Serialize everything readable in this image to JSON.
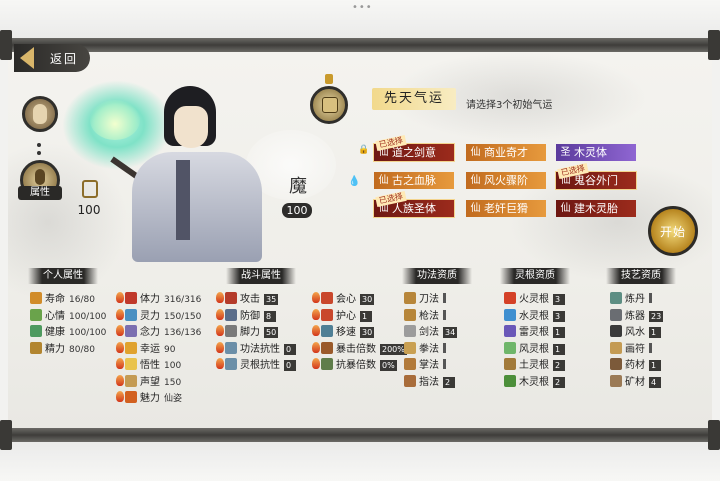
{
  "nav": {
    "back_label": "返回"
  },
  "avatar": {
    "attr_label": "属性"
  },
  "character": {
    "left_value": "100",
    "right_glyph": "魔",
    "right_value": "100"
  },
  "fate": {
    "title": "先天气运",
    "hint": "请选择3个初始气运",
    "chosen_tag": "已选择",
    "traits": [
      {
        "label": "道之剑意",
        "color": "red",
        "selected": true
      },
      {
        "label": "商业奇才",
        "color": "orange",
        "selected": false
      },
      {
        "label": "木灵体",
        "color": "purple",
        "selected": false
      },
      {
        "label": "古之血脉",
        "color": "orange",
        "selected": false
      },
      {
        "label": "风火骤阶",
        "color": "orange",
        "selected": false
      },
      {
        "label": "鬼谷外门",
        "color": "red",
        "selected": true
      },
      {
        "label": "人族圣体",
        "color": "red",
        "selected": true
      },
      {
        "label": "老奸巨猾",
        "color": "orange",
        "selected": false
      },
      {
        "label": "建木灵胎",
        "color": "red",
        "selected": false
      }
    ]
  },
  "start_label": "开始",
  "sections": {
    "personal": "个人属性",
    "combat": "战斗属性",
    "technique": "功法资质",
    "root": "灵根资质",
    "craft": "技艺资质"
  },
  "personal": [
    {
      "label": "寿命",
      "value": "16/80"
    },
    {
      "label": "心情",
      "value": "100/100"
    },
    {
      "label": "健康",
      "value": "100/100"
    },
    {
      "label": "精力",
      "value": "80/80"
    }
  ],
  "personal2": [
    {
      "label": "体力",
      "value": "316/316"
    },
    {
      "label": "灵力",
      "value": "150/150"
    },
    {
      "label": "念力",
      "value": "136/136"
    },
    {
      "label": "幸运",
      "value": "90"
    },
    {
      "label": "悟性",
      "value": "100"
    },
    {
      "label": "声望",
      "value": "150"
    },
    {
      "label": "魅力",
      "value": "仙姿"
    }
  ],
  "combat": [
    {
      "label": "攻击",
      "value": "35"
    },
    {
      "label": "防御",
      "value": "8"
    },
    {
      "label": "脚力",
      "value": "50"
    },
    {
      "label": "功法抗性",
      "value": "0"
    },
    {
      "label": "灵根抗性",
      "value": "0"
    }
  ],
  "combat2": [
    {
      "label": "会心",
      "value": "30"
    },
    {
      "label": "护心",
      "value": "1"
    },
    {
      "label": "移速",
      "value": "30"
    },
    {
      "label": "暴击倍数",
      "value": "200%"
    },
    {
      "label": "抗暴倍数",
      "value": "0%"
    }
  ],
  "technique": [
    {
      "label": "刀法",
      "value": ""
    },
    {
      "label": "枪法",
      "value": ""
    },
    {
      "label": "剑法",
      "value": "34"
    },
    {
      "label": "拳法",
      "value": ""
    },
    {
      "label": "掌法",
      "value": ""
    },
    {
      "label": "指法",
      "value": "2"
    }
  ],
  "root": [
    {
      "label": "火灵根",
      "value": "3"
    },
    {
      "label": "水灵根",
      "value": "3"
    },
    {
      "label": "雷灵根",
      "value": "1"
    },
    {
      "label": "风灵根",
      "value": "1"
    },
    {
      "label": "土灵根",
      "value": "2"
    },
    {
      "label": "木灵根",
      "value": "2"
    }
  ],
  "craft": [
    {
      "label": "炼丹",
      "value": ""
    },
    {
      "label": "炼器",
      "value": "23"
    },
    {
      "label": "风水",
      "value": "1"
    },
    {
      "label": "画符",
      "value": ""
    },
    {
      "label": "药材",
      "value": "1"
    },
    {
      "label": "矿材",
      "value": "4"
    }
  ]
}
